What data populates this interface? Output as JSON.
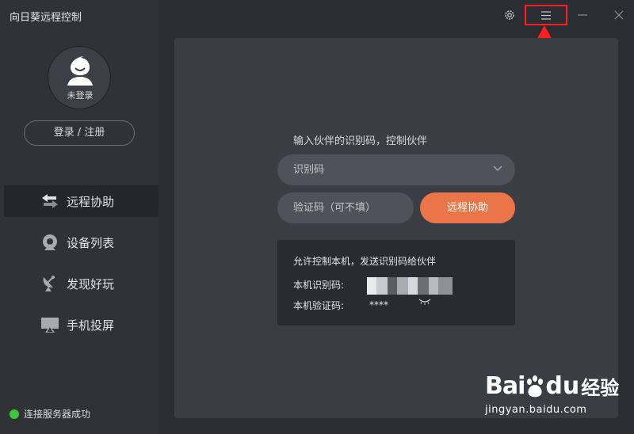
{
  "app": {
    "title": "向日葵远程控制"
  },
  "user": {
    "avatar_label": "未登录",
    "login_button": "登录 / 注册"
  },
  "nav": {
    "items": [
      {
        "label": "远程协助",
        "icon": "arrows-swap-icon",
        "active": true
      },
      {
        "label": "设备列表",
        "icon": "device-pin-icon",
        "active": false
      },
      {
        "label": "发现好玩",
        "icon": "satellite-dish-icon",
        "active": false
      },
      {
        "label": "手机投屏",
        "icon": "screen-cast-icon",
        "active": false
      }
    ]
  },
  "status": {
    "text": "连接服务器成功",
    "color": "#3bc63b"
  },
  "window": {
    "icons": [
      "gear-icon",
      "menu-icon",
      "minimize-icon",
      "close-icon"
    ]
  },
  "assist": {
    "prompt": "输入伙伴的识别码，控制伙伴",
    "id_placeholder": "识别码",
    "code_placeholder": "验证码（可不填）",
    "button": "远程协助",
    "accent": "#e97548"
  },
  "local": {
    "title": "允许控制本机，发送识别码给伙伴",
    "id_label": "本机识别码:",
    "code_label": "本机验证码:",
    "code_value": "****"
  },
  "watermark": {
    "logo_a": "Bai",
    "logo_b": "du",
    "logo_c": "经验",
    "url": "jingyan.baidu.com"
  }
}
